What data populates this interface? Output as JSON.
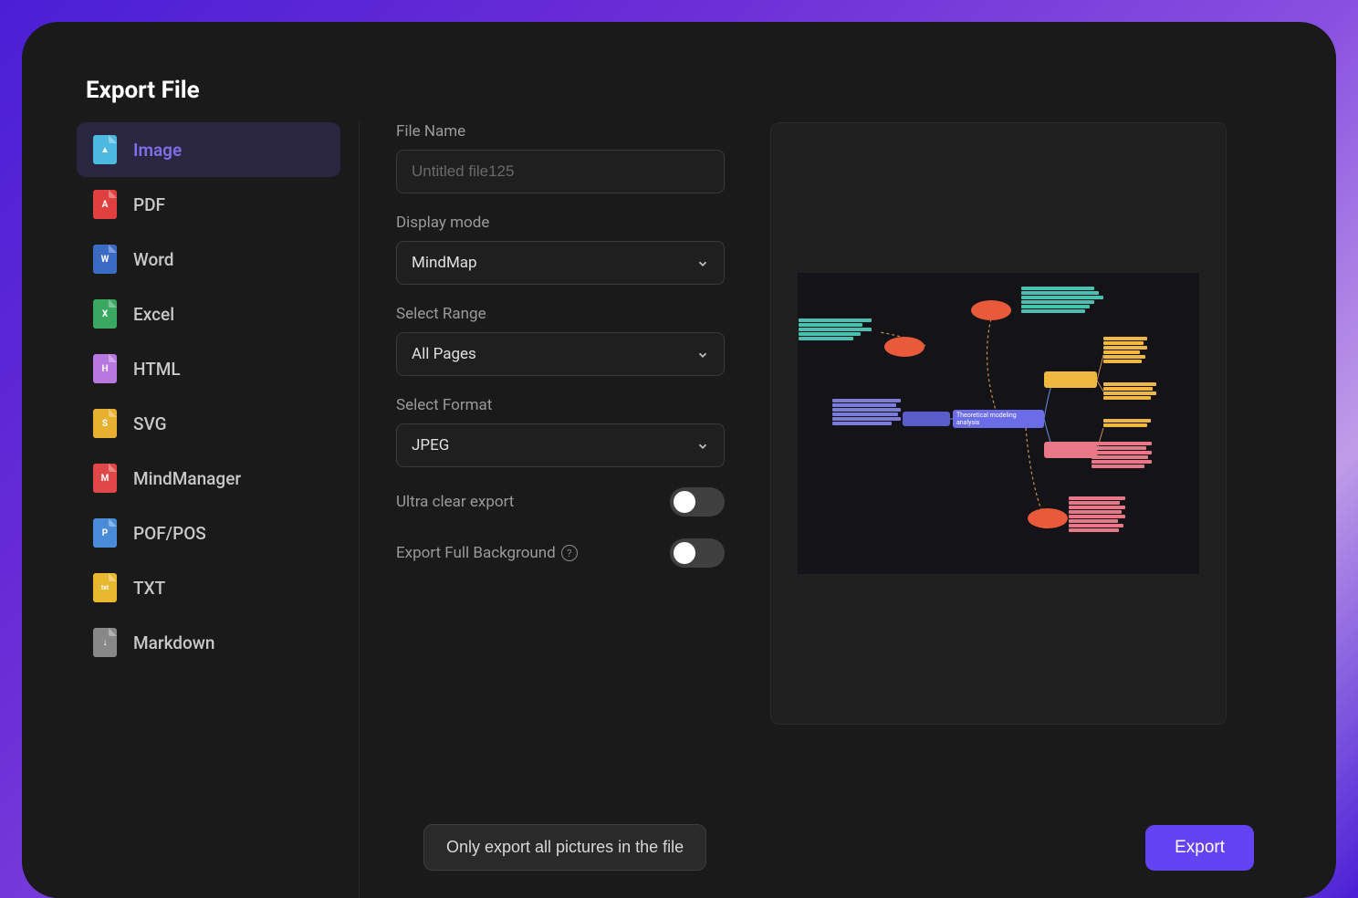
{
  "dialog": {
    "title": "Export File"
  },
  "sidebar": {
    "items": [
      {
        "label": "Image",
        "icon": "image",
        "active": true
      },
      {
        "label": "PDF",
        "icon": "pdf"
      },
      {
        "label": "Word",
        "icon": "word"
      },
      {
        "label": "Excel",
        "icon": "excel"
      },
      {
        "label": "HTML",
        "icon": "html"
      },
      {
        "label": "SVG",
        "icon": "svg"
      },
      {
        "label": "MindManager",
        "icon": "mm"
      },
      {
        "label": "POF/POS",
        "icon": "pof"
      },
      {
        "label": "TXT",
        "icon": "txt"
      },
      {
        "label": "Markdown",
        "icon": "md"
      }
    ]
  },
  "form": {
    "fileName": {
      "label": "File Name",
      "placeholder": "Untitled file125",
      "value": ""
    },
    "displayMode": {
      "label": "Display mode",
      "value": "MindMap"
    },
    "selectRange": {
      "label": "Select Range",
      "value": "All Pages"
    },
    "selectFormat": {
      "label": "Select Format",
      "value": "JPEG"
    },
    "ultraClear": {
      "label": "Ultra clear export",
      "value": false
    },
    "fullBackground": {
      "label": "Export Full Background",
      "value": false
    }
  },
  "preview": {
    "centerNode": "Theoretical modeling analysis"
  },
  "footer": {
    "secondaryButton": "Only export all pictures in the file",
    "primaryButton": "Export"
  },
  "icon_letters": {
    "image": "▲",
    "pdf": "A",
    "word": "W",
    "excel": "X",
    "html": "H",
    "svg": "S",
    "mm": "M",
    "pof": "P",
    "txt": "txt",
    "md": "↓"
  }
}
